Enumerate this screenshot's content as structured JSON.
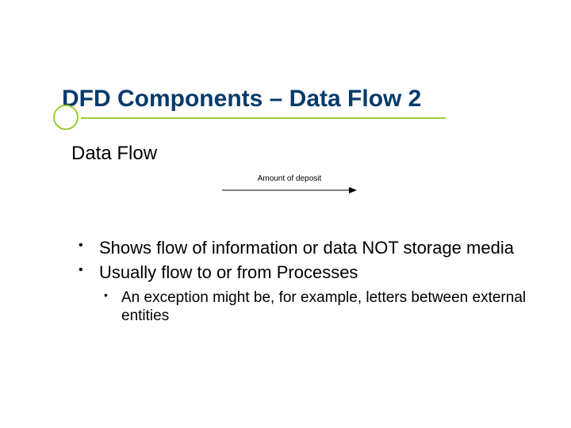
{
  "title": "DFD Components – Data Flow 2",
  "subhead": "Data Flow",
  "arrow_label": "Amount of deposit",
  "bullets_level1": [
    "Shows flow of information or data NOT storage media",
    "Usually flow to or from Processes"
  ],
  "bullets_level2": [
    "An exception might be, for example, letters between external entities"
  ],
  "colors": {
    "title": "#063b6b",
    "accent": "#99cc33",
    "text": "#000000",
    "background": "#ffffff"
  }
}
